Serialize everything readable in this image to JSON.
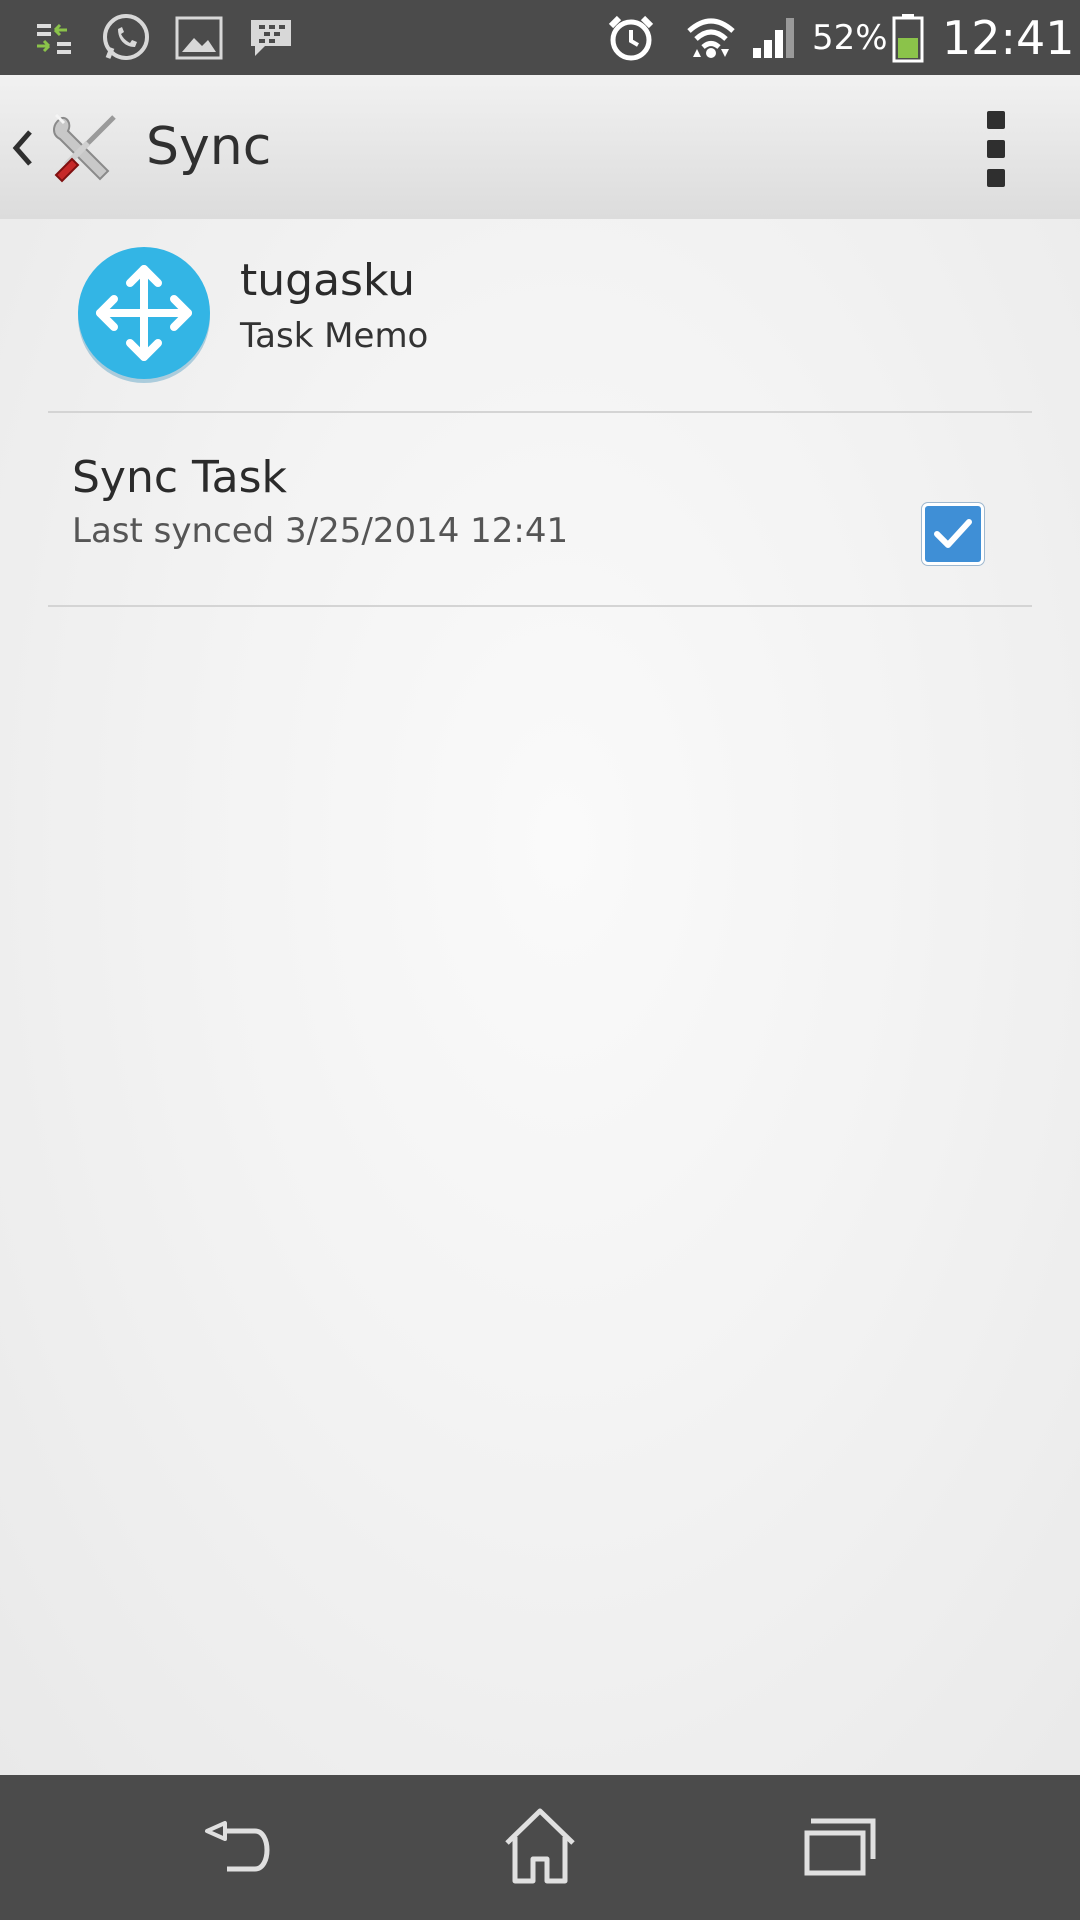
{
  "status_bar": {
    "icons": [
      "data-transfer-icon",
      "whatsapp-icon",
      "gallery-icon",
      "bbm-icon",
      "alarm-icon",
      "wifi-icon",
      "signal-icon",
      "battery-icon"
    ],
    "battery": "52%",
    "battery_level": 0.52,
    "time": "12:41"
  },
  "action_bar": {
    "title": "Sync",
    "icons": [
      "back-chevron-icon",
      "settings-tools-icon",
      "overflow-menu-icon"
    ]
  },
  "account": {
    "name": "tugasku",
    "type": "Task Memo",
    "icon": "move-arrows-icon",
    "icon_color": "#33b5e5"
  },
  "sync_item": {
    "title": "Sync Task",
    "subtitle": "Last synced 3/25/2014 12:41",
    "checked": true,
    "checkbox_color": "#3f8fd6"
  },
  "nav_bar": {
    "icons": [
      "back-icon",
      "home-icon",
      "recent-apps-icon"
    ]
  }
}
